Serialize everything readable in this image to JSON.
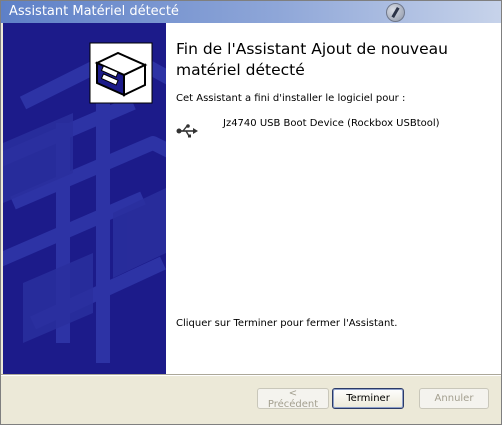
{
  "window": {
    "title": "Assistant Matériel détecté"
  },
  "panel": {
    "heading": "Fin de l'Assistant Ajout de nouveau matériel détecté",
    "intro": "Cet Assistant a fini d'installer le logiciel pour :",
    "device_icon": "usb-icon",
    "device_name": "Jz4740 USB Boot Device (Rockbox USBtool)",
    "outro": "Cliquer sur Terminer pour fermer l'Assistant."
  },
  "sidebar": {
    "icon": "hardware-wizard-icon"
  },
  "buttons": {
    "back_label": "< Précédent",
    "finish_label": "Terminer",
    "cancel_label": "Annuler"
  },
  "colors": {
    "sidebar": "#1c1b8a",
    "titlebar": "#5e80c7"
  }
}
